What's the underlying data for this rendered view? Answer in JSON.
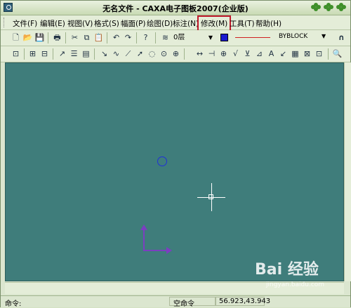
{
  "window": {
    "title": "无名文件 - CAXA电子图板2007(企业版)"
  },
  "menu": [
    {
      "label": "文件(F)"
    },
    {
      "label": "编辑(E)"
    },
    {
      "label": "视图(V)"
    },
    {
      "label": "格式(S)"
    },
    {
      "label": "幅面(P)"
    },
    {
      "label": "绘图(D)"
    },
    {
      "label": "标注(N)"
    },
    {
      "label": "修改(M)",
      "highlighted": true
    },
    {
      "label": "工具(T)"
    },
    {
      "label": "帮助(H)"
    }
  ],
  "toolbar": {
    "layer": "0层",
    "color": "#1a1ad0",
    "linetype": "BYBLOCK"
  },
  "statusbar": {
    "command_label": "命令:",
    "current_command": "空命令",
    "coordinates": "56.923,43.943"
  },
  "watermark": {
    "text": "Bai 经验",
    "sub": "jingyan.baidu.com"
  },
  "colors": {
    "canvas": "#3f7d7b",
    "highlight": "#c0192b",
    "axis": "#7b3fc0",
    "circle": "#2030d8"
  }
}
